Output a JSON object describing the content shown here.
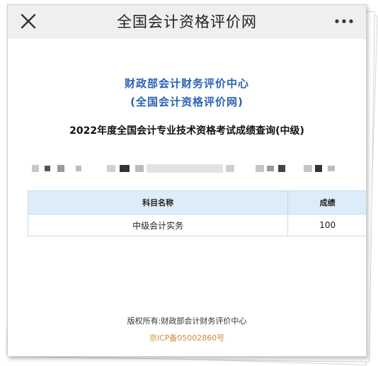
{
  "topbar": {
    "title": "全国会计资格评价网",
    "close_icon": "close-icon",
    "more_icon": "more-icon"
  },
  "header": {
    "org_name": "财政部会计财务评价中心",
    "org_subtitle": "(全国会计资格评价网)"
  },
  "query": {
    "title": "2022年度全国会计专业技术资格考试成绩查询(中级)"
  },
  "table": {
    "headers": [
      "科目名称",
      "成绩"
    ],
    "rows": [
      {
        "subject": "中级会计实务",
        "score": "100"
      }
    ]
  },
  "footer": {
    "copyright": "版权所有:财政部会计财务评价中心",
    "icp": "京ICP备05002860号"
  },
  "colors": {
    "accent_blue": "#2a62b6",
    "table_header_bg": "#dcecf8",
    "icp_orange": "#d08a3a"
  }
}
